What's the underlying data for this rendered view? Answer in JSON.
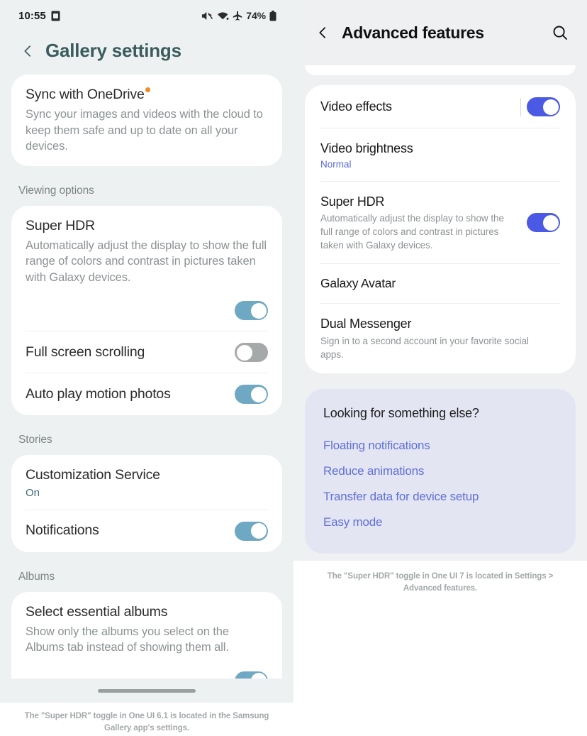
{
  "left_phone": {
    "status_bar": {
      "time": "10:55",
      "icons_left": [
        "sim-card-icon"
      ],
      "icons_right": [
        "mute-icon",
        "wifi-icon",
        "airplane-mode-icon"
      ],
      "battery_text": "74%"
    },
    "header": {
      "back_icon": "chevron-left-icon",
      "title": "Gallery settings",
      "title_color": "#3b5c5e"
    },
    "sync_card": {
      "title": "Sync with OneDrive",
      "badge": "new-badge-dot",
      "badge_color": "#f08a24",
      "description": "Sync your images and videos with the cloud to keep them safe and up to date on all your devices."
    },
    "viewing_options": {
      "section_label": "Viewing options",
      "super_hdr": {
        "title": "Super HDR",
        "description": "Automatically adjust the display to show the full range of colors and contrast in pictures taken with Galaxy devices.",
        "toggle": "on"
      },
      "full_screen_scrolling": {
        "title": "Full screen scrolling",
        "toggle": "off"
      },
      "auto_play_motion_photos": {
        "title": "Auto play motion photos",
        "toggle": "on"
      }
    },
    "stories": {
      "section_label": "Stories",
      "customization_service": {
        "title": "Customization Service",
        "value": "On"
      },
      "notifications": {
        "title": "Notifications",
        "toggle": "on"
      }
    },
    "albums": {
      "section_label": "Albums",
      "select_essential_albums": {
        "title": "Select essential albums",
        "description": "Show only the albums you select on the Albums tab instead of showing them all.",
        "toggle": "on"
      }
    },
    "toggle_on_color": "#6fa8c2",
    "toggle_off_color": "#a6a9aa",
    "caption": "The \"Super HDR\" toggle in One UI 6.1 is located in the Samsung Gallery app's settings."
  },
  "right_phone": {
    "header": {
      "back_icon": "chevron-left-icon",
      "title": "Advanced features",
      "search_icon": "search-icon"
    },
    "features_card": {
      "video_effects": {
        "title": "Video effects",
        "toggle": "on",
        "has_divider": true
      },
      "video_brightness": {
        "title": "Video brightness",
        "value": "Normal"
      },
      "super_hdr": {
        "title": "Super HDR",
        "description": "Automatically adjust the display to show the full range of colors and contrast in pictures taken with Galaxy devices.",
        "toggle": "on"
      },
      "galaxy_avatar": {
        "title": "Galaxy Avatar"
      },
      "dual_messenger": {
        "title": "Dual Messenger",
        "description": "Sign in to a second account in your favorite social apps."
      }
    },
    "looking_for": {
      "title": "Looking for something else?",
      "links": [
        "Floating notifications",
        "Reduce animations",
        "Transfer data for device setup",
        "Easy mode"
      ],
      "card_color": "#e3e5f2",
      "link_color": "#6070d8"
    },
    "toggle_on_color": "#4a5ae4",
    "caption": "The \"Super HDR\" toggle in One UI 7 is located in Settings > Advanced features."
  }
}
